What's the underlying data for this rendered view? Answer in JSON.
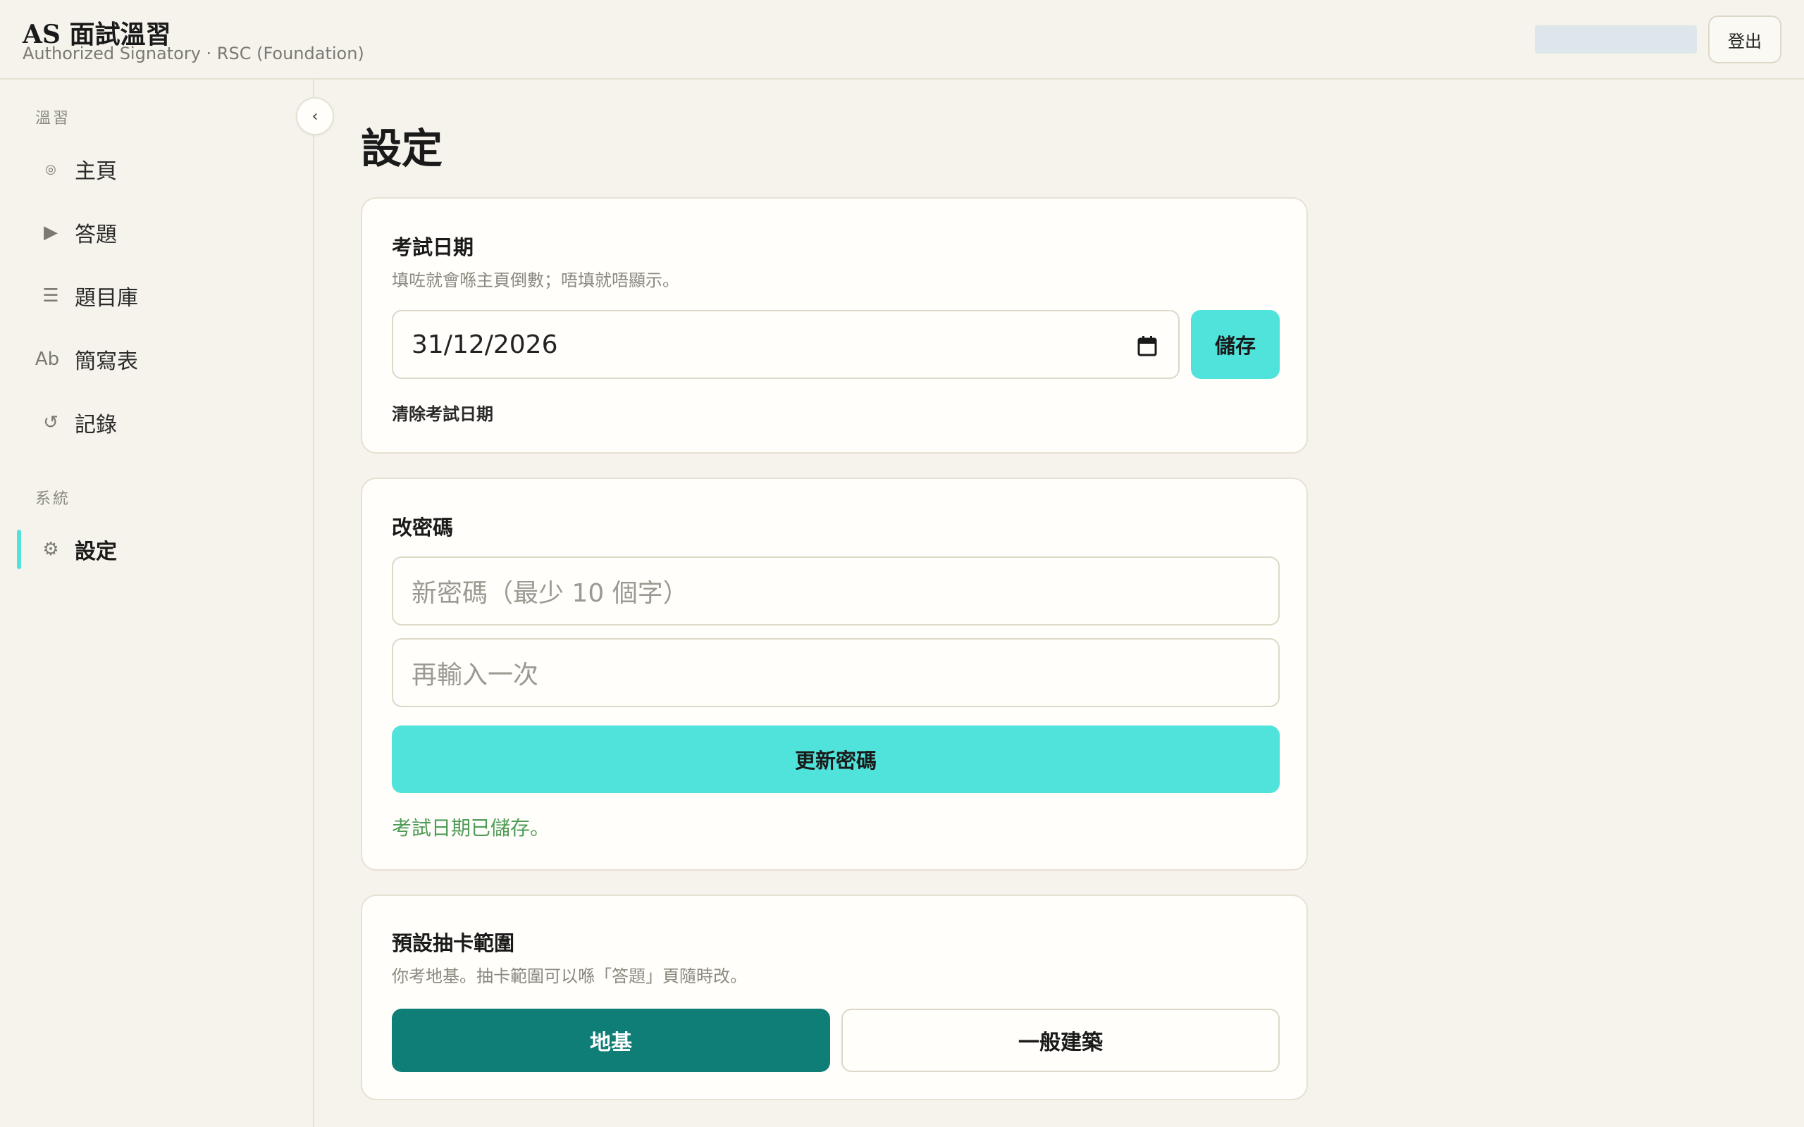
{
  "app": {
    "title": "AS 面試溫習",
    "subtitle": "Authorized Signatory · RSC (Foundation)",
    "logout_label": "登出"
  },
  "sidebar": {
    "collapse_icon": "‹",
    "sections": [
      {
        "label": "溫習",
        "items": [
          {
            "icon": "◎",
            "icon_name": "home-icon",
            "label": "主頁"
          },
          {
            "icon": "▶",
            "icon_name": "play-icon",
            "label": "答題"
          },
          {
            "icon": "☰",
            "icon_name": "list-icon",
            "label": "題目庫"
          },
          {
            "icon": "Ab",
            "icon_name": "abbreviation-icon",
            "label": "簡寫表"
          },
          {
            "icon": "↺",
            "icon_name": "history-icon",
            "label": "記錄"
          }
        ]
      },
      {
        "label": "系統",
        "items": [
          {
            "icon": "⚙",
            "icon_name": "gear-icon",
            "label": "設定",
            "active": true
          }
        ]
      }
    ]
  },
  "main": {
    "page_title": "設定",
    "exam_date": {
      "title": "考試日期",
      "description": "填咗就會喺主頁倒數；唔填就唔顯示。",
      "value": "31/12/2026",
      "save_label": "儲存",
      "clear_label": "清除考試日期"
    },
    "password": {
      "title": "改密碼",
      "new_placeholder": "新密碼（最少 10 個字）",
      "confirm_placeholder": "再輸入一次",
      "update_label": "更新密碼",
      "status": "考試日期已儲存。"
    },
    "draw_scope": {
      "title": "預設抽卡範圍",
      "description": "你考地基。抽卡範圍可以喺「答題」頁隨時改。",
      "options": [
        {
          "label": "地基",
          "selected": true
        },
        {
          "label": "一般建築",
          "selected": false
        }
      ]
    }
  },
  "colors": {
    "accent": "#4fe3dc",
    "selected": "#0f7e76",
    "success": "#4f9b57",
    "background": "#f5f3ec",
    "card": "#fffefa"
  }
}
